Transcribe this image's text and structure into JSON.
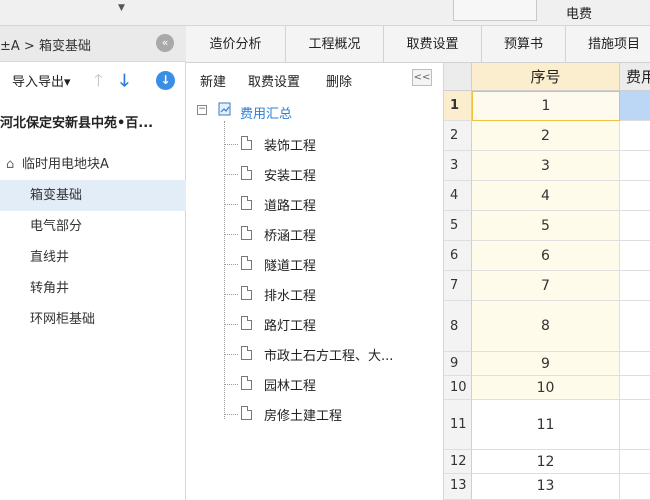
{
  "topbar": {
    "title": "电费",
    "chevron_icon": "chevron-down-icon"
  },
  "left": {
    "breadcrumb": "±A > 箱变基础",
    "collapse_icon": "double-chevron-left-icon",
    "import_export_label": "导入导出▾",
    "project_label": "河北保定安新县中苑•百...",
    "root_node_label": "临时用电地块A",
    "nodes": [
      {
        "label": "箱变基础",
        "selected": true
      },
      {
        "label": "电气部分",
        "selected": false
      },
      {
        "label": "直线井",
        "selected": false
      },
      {
        "label": "转角井",
        "selected": false
      },
      {
        "label": "环网柜基础",
        "selected": false
      }
    ]
  },
  "tabs": [
    "造价分析",
    "工程概况",
    "取费设置",
    "预算书",
    "措施项目"
  ],
  "middle": {
    "toolbar": {
      "new_label": "新建",
      "fee_setting_label": "取费设置",
      "delete_label": "删除",
      "collapse_label": "<<"
    },
    "tree_root": "费用汇总",
    "tree_items": [
      "装饰工程",
      "安装工程",
      "道路工程",
      "桥涵工程",
      "隧道工程",
      "排水工程",
      "路灯工程",
      "市政土石方工程、大...",
      "园林工程",
      "房修土建工程"
    ]
  },
  "grid": {
    "headers": {
      "seq": "序号",
      "fee": "费用"
    },
    "rows": [
      {
        "num": "1",
        "seq": "1"
      },
      {
        "num": "2",
        "seq": "2"
      },
      {
        "num": "3",
        "seq": "3"
      },
      {
        "num": "4",
        "seq": "4"
      },
      {
        "num": "5",
        "seq": "5"
      },
      {
        "num": "6",
        "seq": "6"
      },
      {
        "num": "7",
        "seq": "7"
      },
      {
        "num": "8",
        "seq": "8"
      },
      {
        "num": "9",
        "seq": "9"
      },
      {
        "num": "10",
        "seq": "10"
      },
      {
        "num": "11",
        "seq": "11"
      },
      {
        "num": "12",
        "seq": "12"
      },
      {
        "num": "13",
        "seq": "13"
      }
    ]
  },
  "colors": {
    "accent": "#2b7ed8",
    "selection": "#e3edf8",
    "header_highlight": "#fbeecf"
  }
}
